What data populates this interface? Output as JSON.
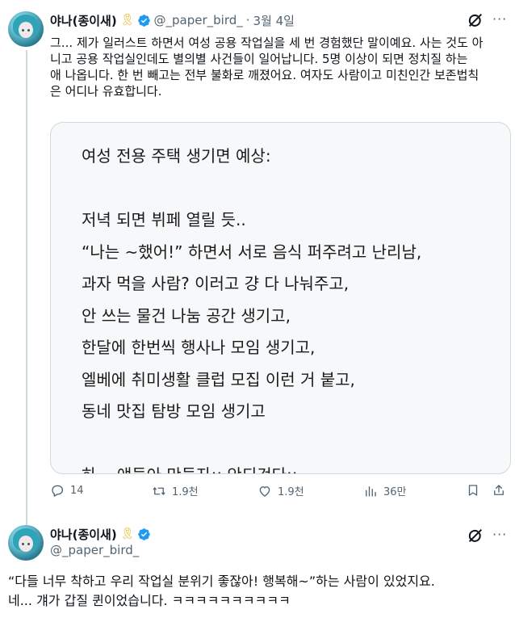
{
  "tweet": {
    "display_name": "야나(종이새)",
    "handle": "@_paper_bird_",
    "separator": "·",
    "date": "3월 4일",
    "text": "그... 제가 일러스트 하면서 여성 공용 작업실을 세 번 경험했단 말이예요. 사는 것도 아\n니고 공용 작업실인데도 별의별 사건들이 일어납니다. 5명 이상이 되면 정치질 하는\n애 나옵니다. 한 번 빼고는 전부 불화로 깨졌어요. 여자도 사람이고 미친인간 보존법칙\n은 어디나 유효합니다.",
    "image_text": "여성 전용 주택 생기면 예상:\n\n저녁 되면 뷔페 열릴 듯..\n“나는 ~했어!” 하면서 서로 음식 퍼주려고 난리남,\n과자 먹을 사람? 이러고 걍 다 나눠주고,\n안 쓰는 물건 나눔 공간 생기고,\n한달에 한번씩 행사나 모임 생기고,\n엘베에 취미생활 클럽 모집 이런 거 붙고,\n동네 맛집 탐방 모임 생기고\n\n하... 얘들아 만들자;; 안되것다;;",
    "actions": {
      "replies": "14",
      "retweets": "1.9천",
      "likes": "1.9천",
      "views": "36만"
    }
  },
  "reply": {
    "display_name": "야나(종이새)",
    "handle": "@_paper_bird_",
    "text": "“다들 너무 착하고 우리 작업실 분위기 좋잖아! 행복해~”하는 사람이 있었지요.\n네... 걔가 갑질 퀸이었습니다. ㅋㅋㅋㅋㅋㅋㅋㅋㅋㅋ"
  },
  "icons": {
    "ribbon": "yellow-ribbon-icon",
    "verified": "verified-badge-icon",
    "grok": "grok-icon",
    "more": "more-options-icon",
    "reply": "reply-icon",
    "retweet": "retweet-icon",
    "like": "heart-icon",
    "views": "views-icon",
    "bookmark": "bookmark-icon",
    "share": "share-icon"
  },
  "colors": {
    "verified": "#1d9bf0",
    "ribbon": "#e8b21a",
    "secondary_text": "#536471",
    "text": "#0f1419",
    "border": "#cfd9de"
  }
}
